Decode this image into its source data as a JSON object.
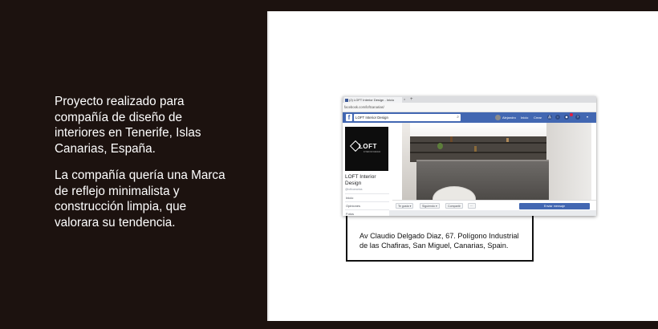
{
  "left_paragraphs": {
    "p1": [
      "Proyecto realizado para",
      "compañía de diseño de",
      "interiores en Tenerife, Islas",
      "Canarias, España."
    ],
    "p2": [
      "La compañía quería una Marca",
      "de reflejo minimalista y",
      "construcción limpia, que",
      "valorara su tendencia."
    ]
  },
  "address_card": {
    "line1": "Av Claudio Delgado Diaz, 67. Polígono Industrial",
    "line2": "de las Chafiras, San Miguel, Canarias, Spain."
  },
  "browser": {
    "tab_title": "(2) LOFT Interior Design - Inicio",
    "tab_close": "×",
    "new_tab": "+",
    "url": "facebook.com/loftcanarias/"
  },
  "facebook": {
    "logo": "f",
    "search_value": "LOFT Interior Design",
    "user_name": "Alejandro",
    "nav_home": "Inicio",
    "nav_create": "Crear",
    "page_name": "LOFT Interior Design",
    "page_handle": "@loftcanarias",
    "logo_text": "LOFT",
    "logo_sub": "INTERIOR DESIGN",
    "sidebar_items": [
      "Inicio",
      "Opiniones",
      "Fotos"
    ],
    "actions": {
      "like": "Te gusta ▾",
      "follow": "Siguiendo ▾",
      "share": "Compartir",
      "more": "···",
      "send_message": "Enviar mensaje"
    }
  },
  "colors": {
    "background": "#1c120f",
    "facebook_blue": "#4267b2"
  }
}
